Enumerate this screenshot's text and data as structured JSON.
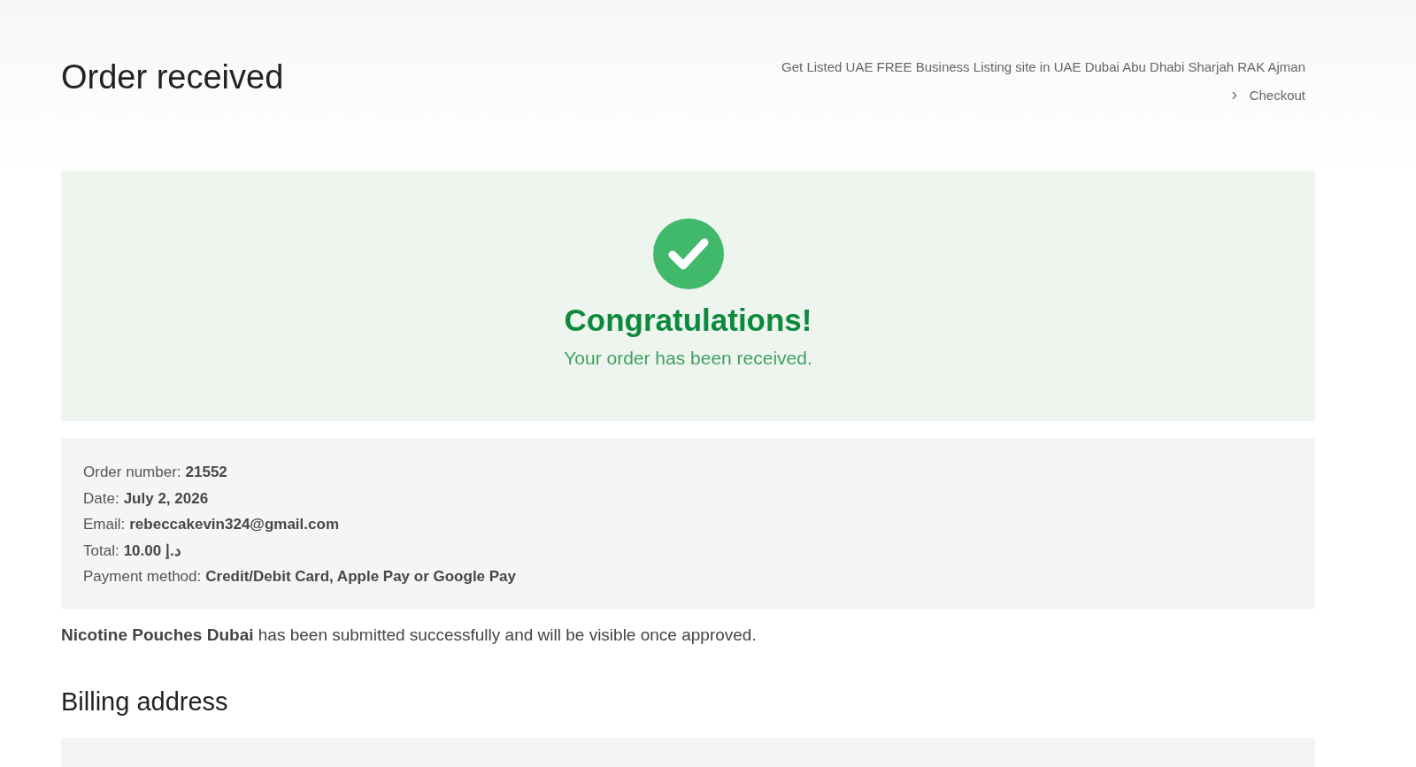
{
  "page": {
    "title": "Order received"
  },
  "breadcrumb": [
    {
      "label": "Get Listed UAE FREE Business Listing site in UAE Dubai Abu Dhabi Sharjah RAK Ajman"
    },
    {
      "label": "Checkout"
    }
  ],
  "success": {
    "heading": "Congratulations!",
    "message": "Your order has been received."
  },
  "order_details": [
    {
      "label": "Order number:",
      "value": "21552"
    },
    {
      "label": "Date:",
      "value": "July 2, 2026"
    },
    {
      "label": "Email:",
      "value": "rebeccakevin324@gmail.com"
    },
    {
      "label": "Total:",
      "value": "10.00 د.إ"
    },
    {
      "label": "Payment method:",
      "value": "Credit/Debit Card, Apple Pay or Google Pay"
    }
  ],
  "notice": "**Nicotine Pouches Dubai** has been submitted successfully and will be visible once approved.",
  "billing": {
    "heading": "Billing address"
  }
}
